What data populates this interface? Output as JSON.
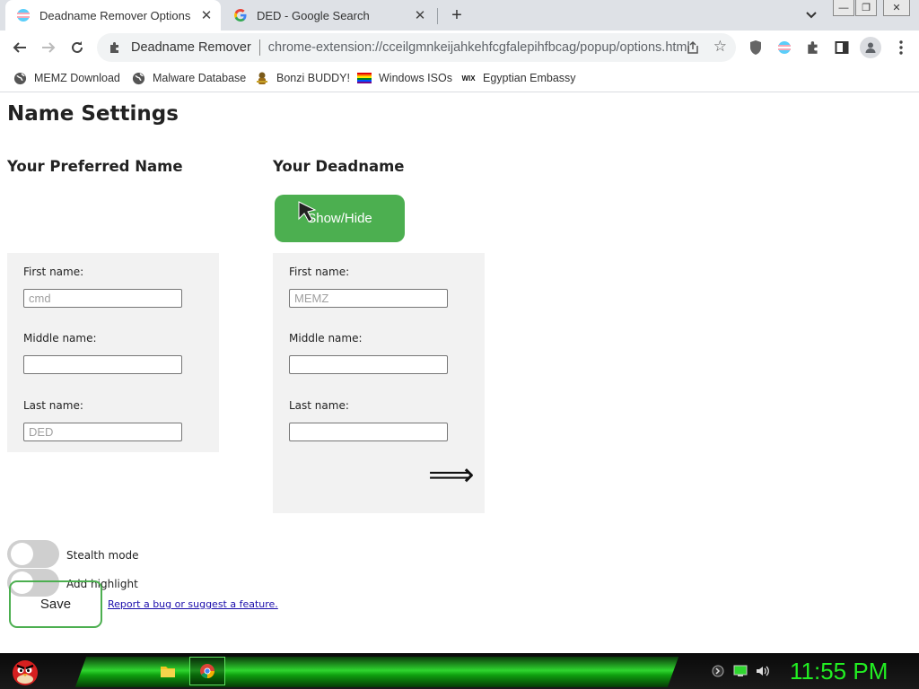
{
  "tabs": [
    {
      "title": "Deadname Remover Options",
      "icon": "trans-flag-icon",
      "active": true
    },
    {
      "title": "DED - Google Search",
      "icon": "google-icon",
      "active": false
    }
  ],
  "window_controls": {
    "minimize": "—",
    "restore": "❐",
    "close": "✕"
  },
  "toolbar": {
    "site_name": "Deadname Remover",
    "url": "chrome-extension://cceilgmnkeijahkehfcgfalepihfbcag/popup/options.html"
  },
  "bookmarks": [
    {
      "label": "MEMZ Download",
      "icon": "globe-icon"
    },
    {
      "label": "Malware Database",
      "icon": "globe-icon"
    },
    {
      "label": "Bonzi BUDDY!",
      "icon": "bonzi-icon"
    },
    {
      "label": "Windows ISOs",
      "icon": "rainbow-flag-icon"
    },
    {
      "label": "Egyptian Embassy",
      "icon": "wix-icon"
    }
  ],
  "page": {
    "title": "Name Settings",
    "preferred": {
      "heading": "Your Preferred Name",
      "first_label": "First name:",
      "first_placeholder": "cmd",
      "middle_label": "Middle name:",
      "middle_placeholder": "",
      "last_label": "Last name:",
      "last_placeholder": "DED"
    },
    "deadname": {
      "heading": "Your Deadname",
      "show_hide": "Show/Hide",
      "first_label": "First name:",
      "first_placeholder": "MEMZ",
      "middle_label": "Middle name:",
      "middle_placeholder": "",
      "last_label": "Last name:",
      "last_placeholder": "",
      "arrow": "⟹"
    },
    "toggles": [
      {
        "label": "Stealth mode",
        "on": false
      },
      {
        "label": "Add highlight",
        "on": false
      }
    ],
    "save": "Save",
    "report_link": "Report a bug or suggest a feature.",
    "accent_color": "#4caf50"
  },
  "taskbar": {
    "clock": "11:55 PM",
    "apps": [
      "file-explorer-icon",
      "chrome-icon"
    ]
  }
}
